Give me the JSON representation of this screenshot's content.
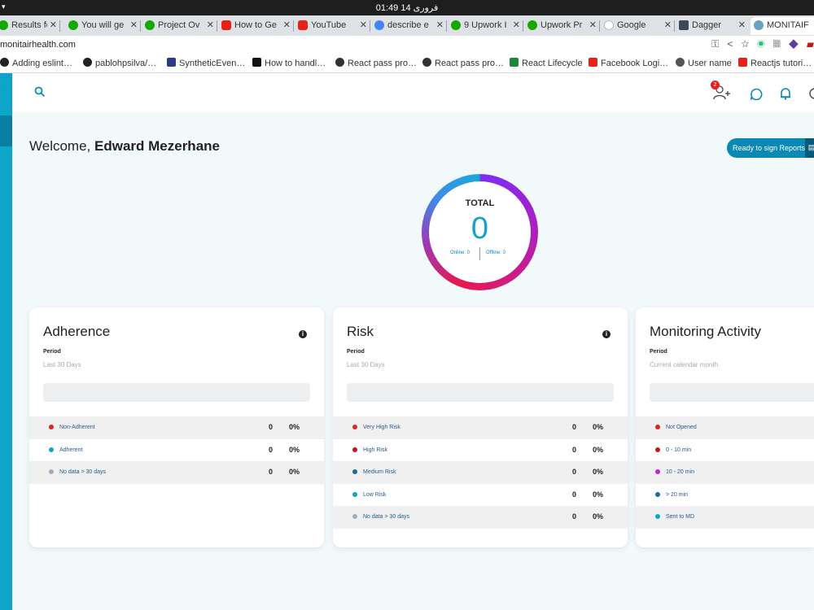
{
  "os": {
    "clock": "01:49  فروری 14"
  },
  "tabs": [
    {
      "label": "Results fo",
      "color": "#14a800"
    },
    {
      "label": "You will ge",
      "color": "#14a800"
    },
    {
      "label": "Project Ov",
      "color": "#14a800"
    },
    {
      "label": "How to Ge",
      "color": "#e62117"
    },
    {
      "label": "YouTube",
      "color": "#e62117"
    },
    {
      "label": "describe e",
      "color": "#4285f4"
    },
    {
      "label": "9 Upwork I",
      "color": "#14a800"
    },
    {
      "label": "Upwork Pr",
      "color": "#14a800"
    },
    {
      "label": "Google",
      "color": "#dddddd"
    },
    {
      "label": "Dagger",
      "color": "#3b4a5a"
    },
    {
      "label": "MONITAIF",
      "color": "#6aa0c0"
    }
  ],
  "address": {
    "url": "monitairhealth.com"
  },
  "bookmarks": [
    {
      "label": "Adding eslint…",
      "color": "#222"
    },
    {
      "label": "pablohpsilva/…",
      "color": "#222"
    },
    {
      "label": "SyntheticEven…",
      "color": "#2a3a8a"
    },
    {
      "label": "How to handl…",
      "color": "#111"
    },
    {
      "label": "React pass pro…",
      "color": "#333"
    },
    {
      "label": "React pass pro…",
      "color": "#333"
    },
    {
      "label": "React Lifecycle",
      "color": "#1a8a3a"
    },
    {
      "label": "Facebook Logi…",
      "color": "#e62117"
    },
    {
      "label": "User name",
      "color": "#555"
    },
    {
      "label": "Reactjs tutori…",
      "color": "#e62117"
    }
  ],
  "header": {
    "notification_count": "2"
  },
  "welcome": {
    "prefix": "Welcome, ",
    "name": "Edward Mezerhane"
  },
  "sign_button": {
    "label": "Ready to sign Reports"
  },
  "total": {
    "title": "TOTAL",
    "value": "0",
    "online": "Online: 0",
    "offline": "Offline: 0"
  },
  "cards": [
    {
      "title": "Adherence",
      "period_label": "Period",
      "period_value": "Last 30 Days",
      "rows": [
        {
          "label": "Non-Adherent",
          "count": "0",
          "pct": "0%",
          "color": "#e02424"
        },
        {
          "label": "Adherent",
          "count": "0",
          "pct": "0%",
          "color": "#0ea5c9"
        },
        {
          "label": "No data > 30 days",
          "count": "0",
          "pct": "0%",
          "color": "#a0aec0"
        }
      ]
    },
    {
      "title": "Risk",
      "period_label": "Period",
      "period_value": "Last 30 Days",
      "rows": [
        {
          "label": "Very High Risk",
          "count": "0",
          "pct": "0%",
          "color": "#e02424"
        },
        {
          "label": "High Risk",
          "count": "0",
          "pct": "0%",
          "color": "#b91c1c"
        },
        {
          "label": "Medium Risk",
          "count": "0",
          "pct": "0%",
          "color": "#1e6a9a"
        },
        {
          "label": "Low Risk",
          "count": "0",
          "pct": "0%",
          "color": "#0ea5c9"
        },
        {
          "label": "No data > 30 days",
          "count": "0",
          "pct": "0%",
          "color": "#a0aec0"
        }
      ]
    },
    {
      "title": "Monitoring Activity",
      "period_label": "Period",
      "period_value": "Current calendar month",
      "rows": [
        {
          "label": "Not Opened",
          "count": "",
          "pct": "",
          "color": "#e02424"
        },
        {
          "label": "0 - 10 min",
          "count": "",
          "pct": "",
          "color": "#b91c1c"
        },
        {
          "label": "10 - 20 min",
          "count": "",
          "pct": "",
          "color": "#c026d3"
        },
        {
          "label": "> 20 min",
          "count": "",
          "pct": "",
          "color": "#1e6a9a"
        },
        {
          "label": "Sent to MD",
          "count": "",
          "pct": "",
          "color": "#0ea5c9"
        }
      ]
    }
  ]
}
